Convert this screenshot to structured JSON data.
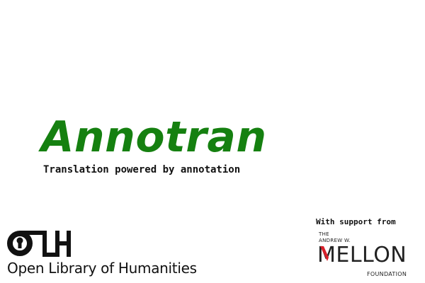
{
  "title": "Annotran",
  "subtitle": "Translation powered by annotation",
  "olh": {
    "logo_icon": "olh-monogram-logo",
    "name": "Open Library of Humanities"
  },
  "support": {
    "label": "With support from",
    "mellon": {
      "the": "THE",
      "andrew": "ANDREW W.",
      "name": "MELLON",
      "foundation": "FOUNDATION",
      "accent_color": "#d8202a"
    }
  },
  "colors": {
    "title": "#158010",
    "text": "#111111",
    "background": "#ffffff"
  }
}
